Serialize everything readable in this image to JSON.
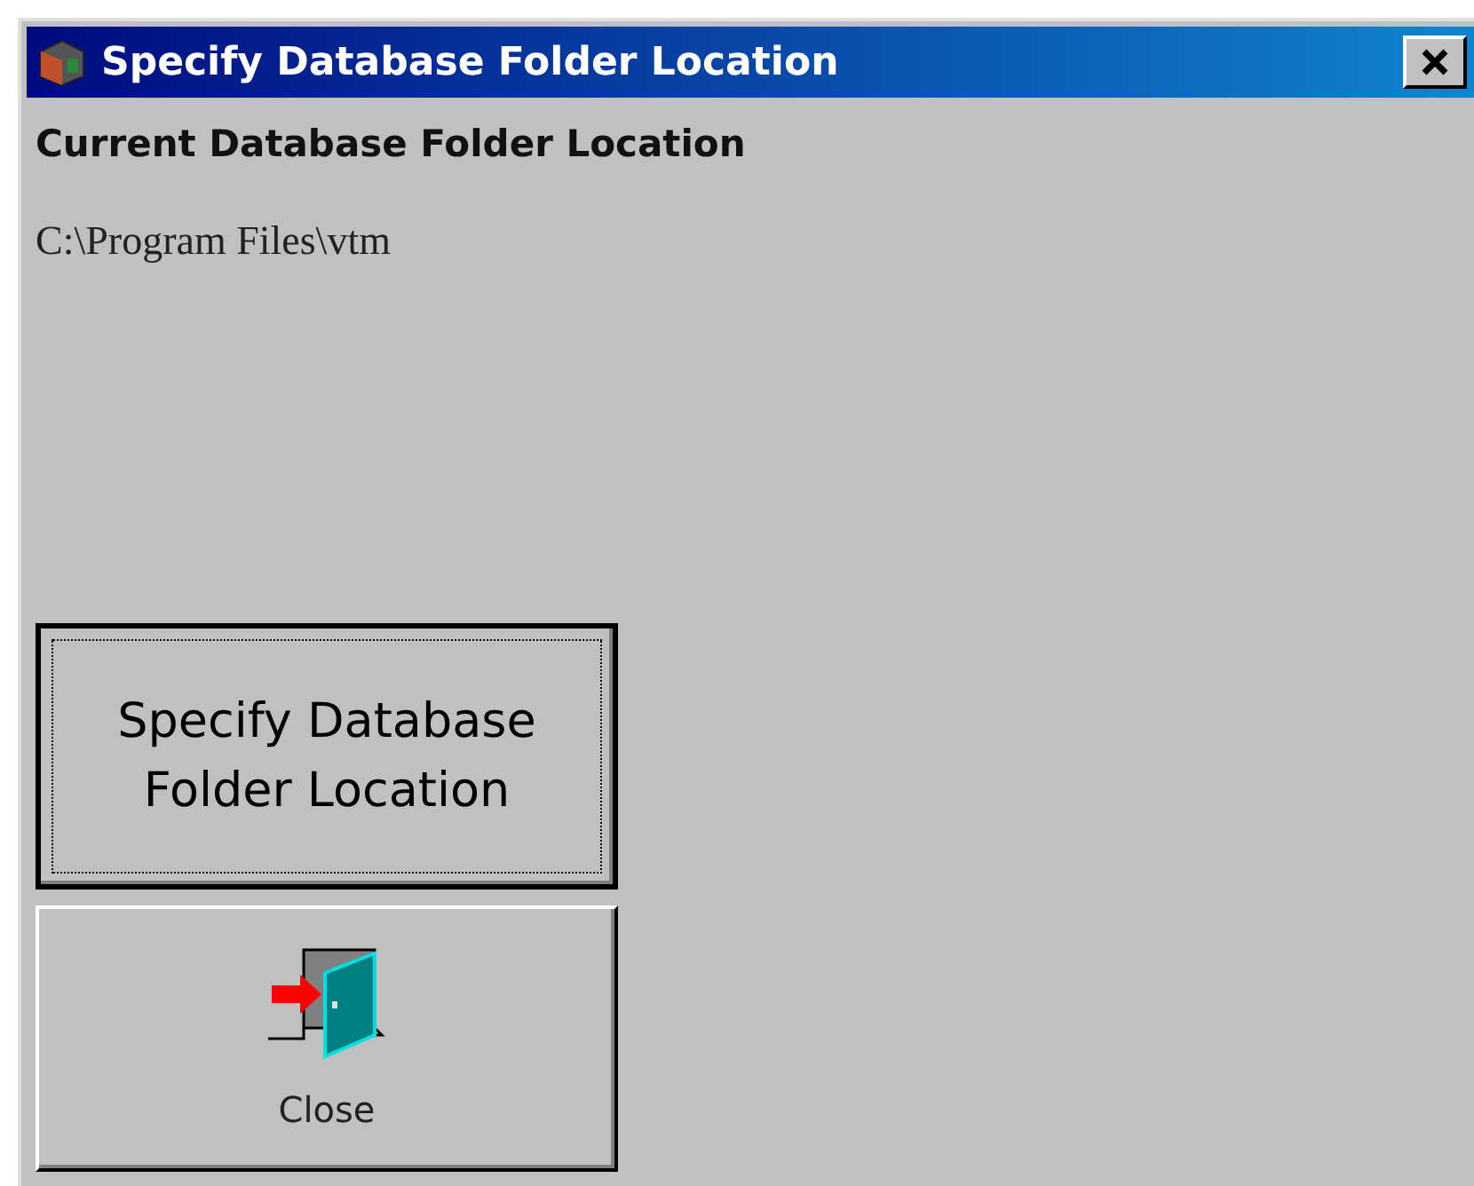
{
  "window": {
    "title": "Specify Database Folder Location"
  },
  "heading": "Current Database Folder Location",
  "path": "C:\\Program Files\\vtm",
  "buttons": [
    {
      "label": "Specify Database Folder Location",
      "kind": "text",
      "focused": true
    },
    {
      "label": "Close",
      "kind": "icon",
      "focused": false
    }
  ]
}
